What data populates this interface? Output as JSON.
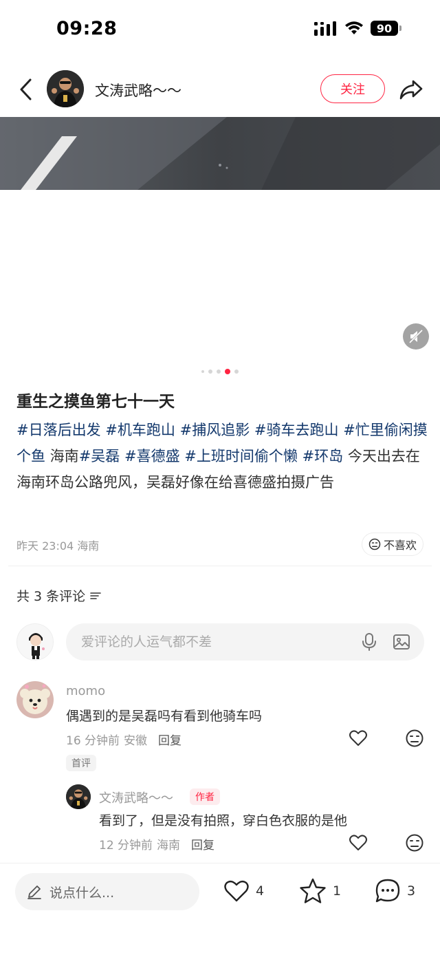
{
  "status_bar": {
    "time": "09:28",
    "battery": "90"
  },
  "header": {
    "author_name": "文涛武略～～",
    "follow_label": "关注"
  },
  "note": {
    "title": "重生之摸鱼第七十一天",
    "body": [
      {
        "text": "#日落后出发",
        "tag": true
      },
      {
        "text": " ",
        "tag": false
      },
      {
        "text": "#机车跑山",
        "tag": true
      },
      {
        "text": " ",
        "tag": false
      },
      {
        "text": "#捕风追影",
        "tag": true
      },
      {
        "text": " ",
        "tag": false
      },
      {
        "text": "#骑车去跑山",
        "tag": true
      },
      {
        "text": " ",
        "tag": false
      },
      {
        "text": "#忙里偷闲摸个鱼",
        "tag": true
      },
      {
        "text": " 海南",
        "tag": false
      },
      {
        "text": "#吴磊",
        "tag": true
      },
      {
        "text": " ",
        "tag": false
      },
      {
        "text": "#喜德盛",
        "tag": true
      },
      {
        "text": " ",
        "tag": false
      },
      {
        "text": "#上班时间偷个懒",
        "tag": true
      },
      {
        "text": " ",
        "tag": false
      },
      {
        "text": "#环岛",
        "tag": true
      },
      {
        "text": " 今天出去在海南环岛公路兜风，吴磊好像在给喜德盛拍摄广告",
        "tag": false
      }
    ],
    "meta": "昨天 23:04 海南",
    "dislike_label": "不喜欢",
    "carousel": {
      "count": 5,
      "active_index": 3
    }
  },
  "comments_section": {
    "count_label": "共 3 条评论",
    "input_placeholder": "爱评论的人运气都不差",
    "comments": [
      {
        "user": "momo",
        "text": "偶遇到的是吴磊吗有看到他骑车吗",
        "time": "16 分钟前",
        "location": "安徽",
        "reply_label": "回复",
        "badge": "首评"
      },
      {
        "user": "文涛武略～～",
        "text": "看到了，但是没有拍照，穿白色衣服的是他",
        "time": "12 分钟前",
        "location": "海南",
        "reply_label": "回复",
        "badge": "作者"
      }
    ]
  },
  "bottom_bar": {
    "input_placeholder": "说点什么...",
    "likes": "4",
    "collects": "1",
    "comments": "3"
  },
  "colors": {
    "accent": "#ff2442",
    "tag": "#13386c",
    "muted": "#999999"
  }
}
